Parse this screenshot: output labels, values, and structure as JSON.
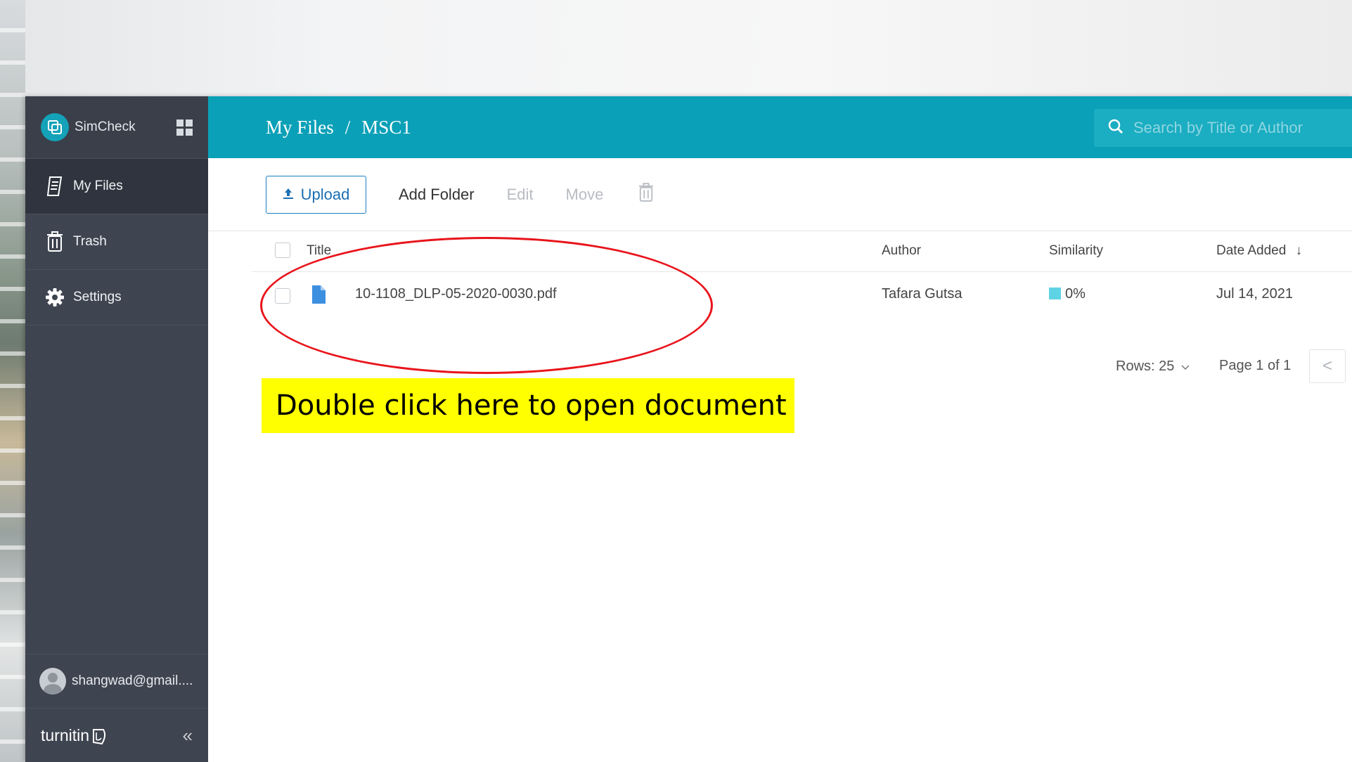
{
  "app": {
    "name": "SimCheck"
  },
  "sidebar": {
    "items": [
      {
        "label": "My Files",
        "icon": "my-files-icon",
        "active": true
      },
      {
        "label": "Trash",
        "icon": "trash-icon",
        "active": false
      },
      {
        "label": "Settings",
        "icon": "gear-icon",
        "active": false
      }
    ],
    "user": "shangwad@gmail....",
    "footer_logo": "turnitin",
    "collapse_glyph": "«"
  },
  "header": {
    "breadcrumb": [
      "My Files",
      "MSC1"
    ],
    "separator": "/",
    "search_placeholder": "Search by Title or Author"
  },
  "toolbar": {
    "upload_label": "Upload",
    "add_folder_label": "Add Folder",
    "edit_label": "Edit",
    "move_label": "Move"
  },
  "table": {
    "columns": [
      "Title",
      "Author",
      "Similarity",
      "Date Added"
    ],
    "sort_indicator": "↓",
    "rows": [
      {
        "title": "10-1108_DLP-05-2020-0030.pdf",
        "author": "Tafara Gutsa",
        "similarity": "0%",
        "date_added": "Jul 14, 2021"
      }
    ]
  },
  "pagination": {
    "rows_label": "Rows: 25",
    "page_label": "Page 1 of 1",
    "prev_glyph": "<"
  },
  "annotation": {
    "callout_text": "Double click here to open document"
  },
  "colors": {
    "header": "#0aa0b7",
    "sidebar": "#3e4450",
    "sidebar_active": "#2f343e",
    "upload_border": "#1b7fc4",
    "similarity_low": "#5ed3e4",
    "annotation_ring": "#e8141b",
    "annotation_highlight": "#ffff00"
  }
}
